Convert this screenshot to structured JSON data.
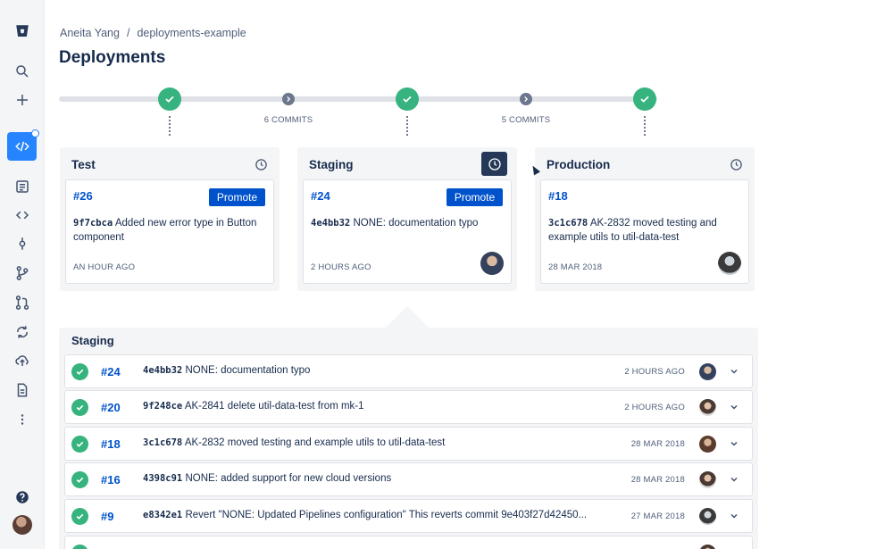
{
  "breadcrumb": {
    "user": "Aneita Yang",
    "separator": "/",
    "repo": "deployments-example"
  },
  "page": {
    "title": "Deployments"
  },
  "pipeline": {
    "commits_between_1": "6 COMMITS",
    "commits_between_2": "5 COMMITS"
  },
  "environments": [
    {
      "name": "Test",
      "deploy": "#26",
      "promote_label": "Promote",
      "hash": "9f7cbca",
      "message": "Added new error type in Button component",
      "time": "AN HOUR AGO"
    },
    {
      "name": "Staging",
      "deploy": "#24",
      "promote_label": "Promote",
      "hash": "4e4bb32",
      "message": "NONE: documentation typo",
      "time": "2 HOURS AGO"
    },
    {
      "name": "Production",
      "deploy": "#18",
      "hash": "3c1c678",
      "message": "AK-2832 moved testing and example utils to util-data-test",
      "time": "28 MAR 2018"
    }
  ],
  "staging_list": {
    "title": "Staging",
    "rows": [
      {
        "num": "#24",
        "hash": "4e4bb32",
        "message": "NONE: documentation typo",
        "time": "2 HOURS AGO"
      },
      {
        "num": "#20",
        "hash": "9f248ce",
        "message": "AK-2841 delete util-data-test from mk-1",
        "time": "2 HOURS AGO"
      },
      {
        "num": "#18",
        "hash": "3c1c678",
        "message": "AK-2832 moved testing and example utils to util-data-test",
        "time": "28 MAR 2018"
      },
      {
        "num": "#16",
        "hash": "4398c91",
        "message": "NONE: added support for new cloud versions",
        "time": "28 MAR 2018"
      },
      {
        "num": "#9",
        "hash": "e8342e1",
        "message": "Revert \"NONE: Updated Pipelines configuration\" This reverts commit 9e403f27d42450...",
        "time": "27 MAR 2018"
      }
    ]
  },
  "colors": {
    "success": "#36b37e",
    "primary": "#0052cc",
    "sidebar_active": "#2684ff",
    "panel_bg": "#f4f5f7"
  },
  "icons": {
    "sidebar": [
      "bitbucket-logo-icon",
      "search-icon",
      "plus-icon",
      "source-code-icon",
      "overview-icon",
      "code-icon",
      "commits-icon",
      "branches-icon",
      "pull-requests-icon",
      "pipelines-icon",
      "deployments-icon",
      "downloads-icon",
      "more-icon",
      "help-icon",
      "user-avatar"
    ]
  }
}
